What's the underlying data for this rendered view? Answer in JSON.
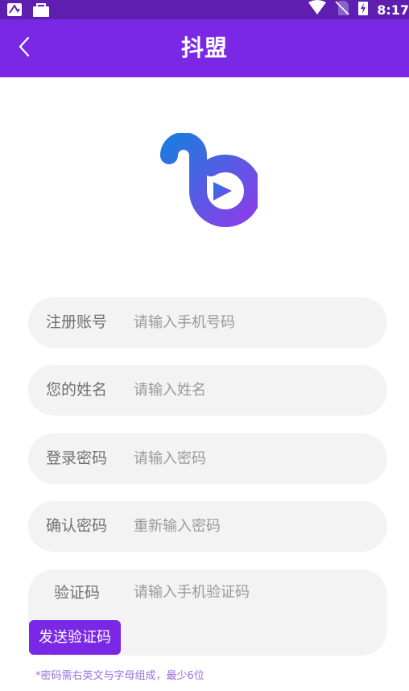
{
  "status_bar": {
    "time": "8:17",
    "icons": [
      "app-icon",
      "bag-icon",
      "wifi-icon",
      "no-sim-icon",
      "battery-charging-icon"
    ]
  },
  "app_bar": {
    "title": "抖盟",
    "back_icon": "chevron-left-icon"
  },
  "logo": {
    "icon": "brand-b-logo",
    "colors": [
      "#1f7ae0",
      "#8a3ee8"
    ]
  },
  "form": {
    "fields": [
      {
        "label": "注册账号",
        "placeholder": "请输入手机号码"
      },
      {
        "label": "您的姓名",
        "placeholder": "请输入姓名"
      },
      {
        "label": "登录密码",
        "placeholder": "请输入密码"
      },
      {
        "label": "确认密码",
        "placeholder": "重新输入密码"
      },
      {
        "label": "验证码",
        "placeholder": "请输入手机验证码"
      }
    ],
    "send_code_label": "发送验证码",
    "hint": "*密码需右英文与字母组成，最少6位"
  },
  "colors": {
    "status_bar": "#5e1fb0",
    "primary": "#7a28e6",
    "field_bg": "#f3f3f3",
    "hint": "#9b6fe0"
  }
}
